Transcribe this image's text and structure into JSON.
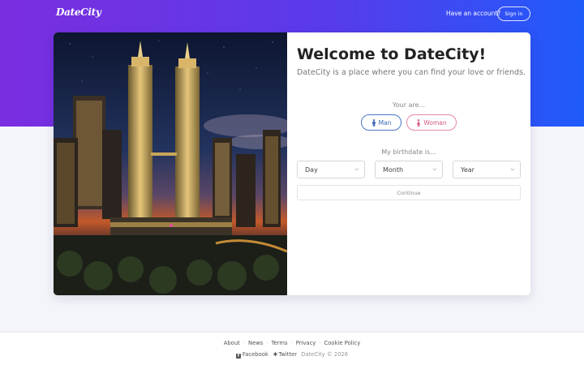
{
  "brand": {
    "logo": "DateCity"
  },
  "header": {
    "have_account": "Have an account?",
    "signin_label": "Sign in"
  },
  "welcome": {
    "title": "Welcome to DateCity!",
    "subtitle": "DateCity is a place where you can find your love or friends."
  },
  "gender": {
    "question": "Your are...",
    "man_label": "Man",
    "woman_label": "Woman"
  },
  "birthdate": {
    "question": "My birthdate is...",
    "day": "Day",
    "month": "Month",
    "year": "Year"
  },
  "continue_label": "Continue",
  "footer": {
    "links": [
      "About",
      "News",
      "Terms",
      "Privacy",
      "Cookie Policy"
    ],
    "facebook": "Facebook",
    "twitter": "Twitter",
    "copyright": "DateCity © 2026"
  },
  "colors": {
    "gradient_start": "#7b2ee0",
    "gradient_end": "#1e5bfb",
    "man": "#3c69b8",
    "woman": "#d1597f"
  }
}
